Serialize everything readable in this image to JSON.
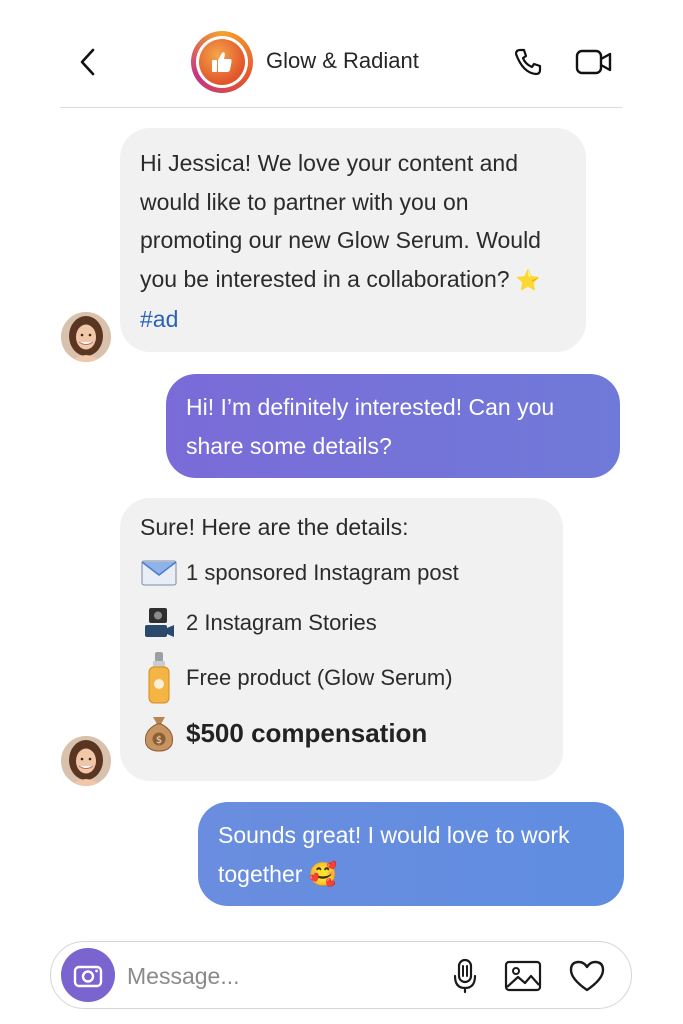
{
  "header": {
    "title": "Glow & Radiant",
    "back_icon": "chevron-left-icon",
    "call_icon": "phone-icon",
    "video_icon": "video-camera-icon",
    "brand_logo_icon": "thumbs-up-icon"
  },
  "messages": [
    {
      "direction": "incoming",
      "text": "Hi Jessica! We love your content and would like to partner with you on promoting our new Glow Serum. Would you be interested in a collaboration?",
      "emoji": "⭐",
      "hashtag": "#ad"
    },
    {
      "direction": "outgoing",
      "text": "Hi! I’m definitely interested! Can you share some details?"
    },
    {
      "direction": "incoming",
      "heading": "Sure! Here are the details:",
      "items": [
        {
          "icon": "envelope-icon",
          "label": "1 sponsored Instagram post"
        },
        {
          "icon": "video-camera-icon",
          "label": "2 Instagram Stories"
        },
        {
          "icon": "serum-bottle-icon",
          "label": "Free product (Glow Serum)"
        },
        {
          "icon": "money-bag-icon",
          "label": "$500 compensation"
        }
      ]
    },
    {
      "direction": "outgoing",
      "text": "Sounds great! I would love to work together",
      "emoji": "🥰"
    }
  ],
  "composer": {
    "placeholder": "Message...",
    "value": "",
    "camera_icon": "camera-icon",
    "attach_icon": "microphone-icon",
    "gallery_icon": "image-icon",
    "like_icon": "heart-icon"
  },
  "colors": {
    "incoming_bubble": "#f1f1f1",
    "outgoing_bubble": "#7b6bd8",
    "outgoing_bubble_alt": "#6a8ddf",
    "hashtag": "#2a62b8",
    "camera_button": "#7a64cf"
  }
}
